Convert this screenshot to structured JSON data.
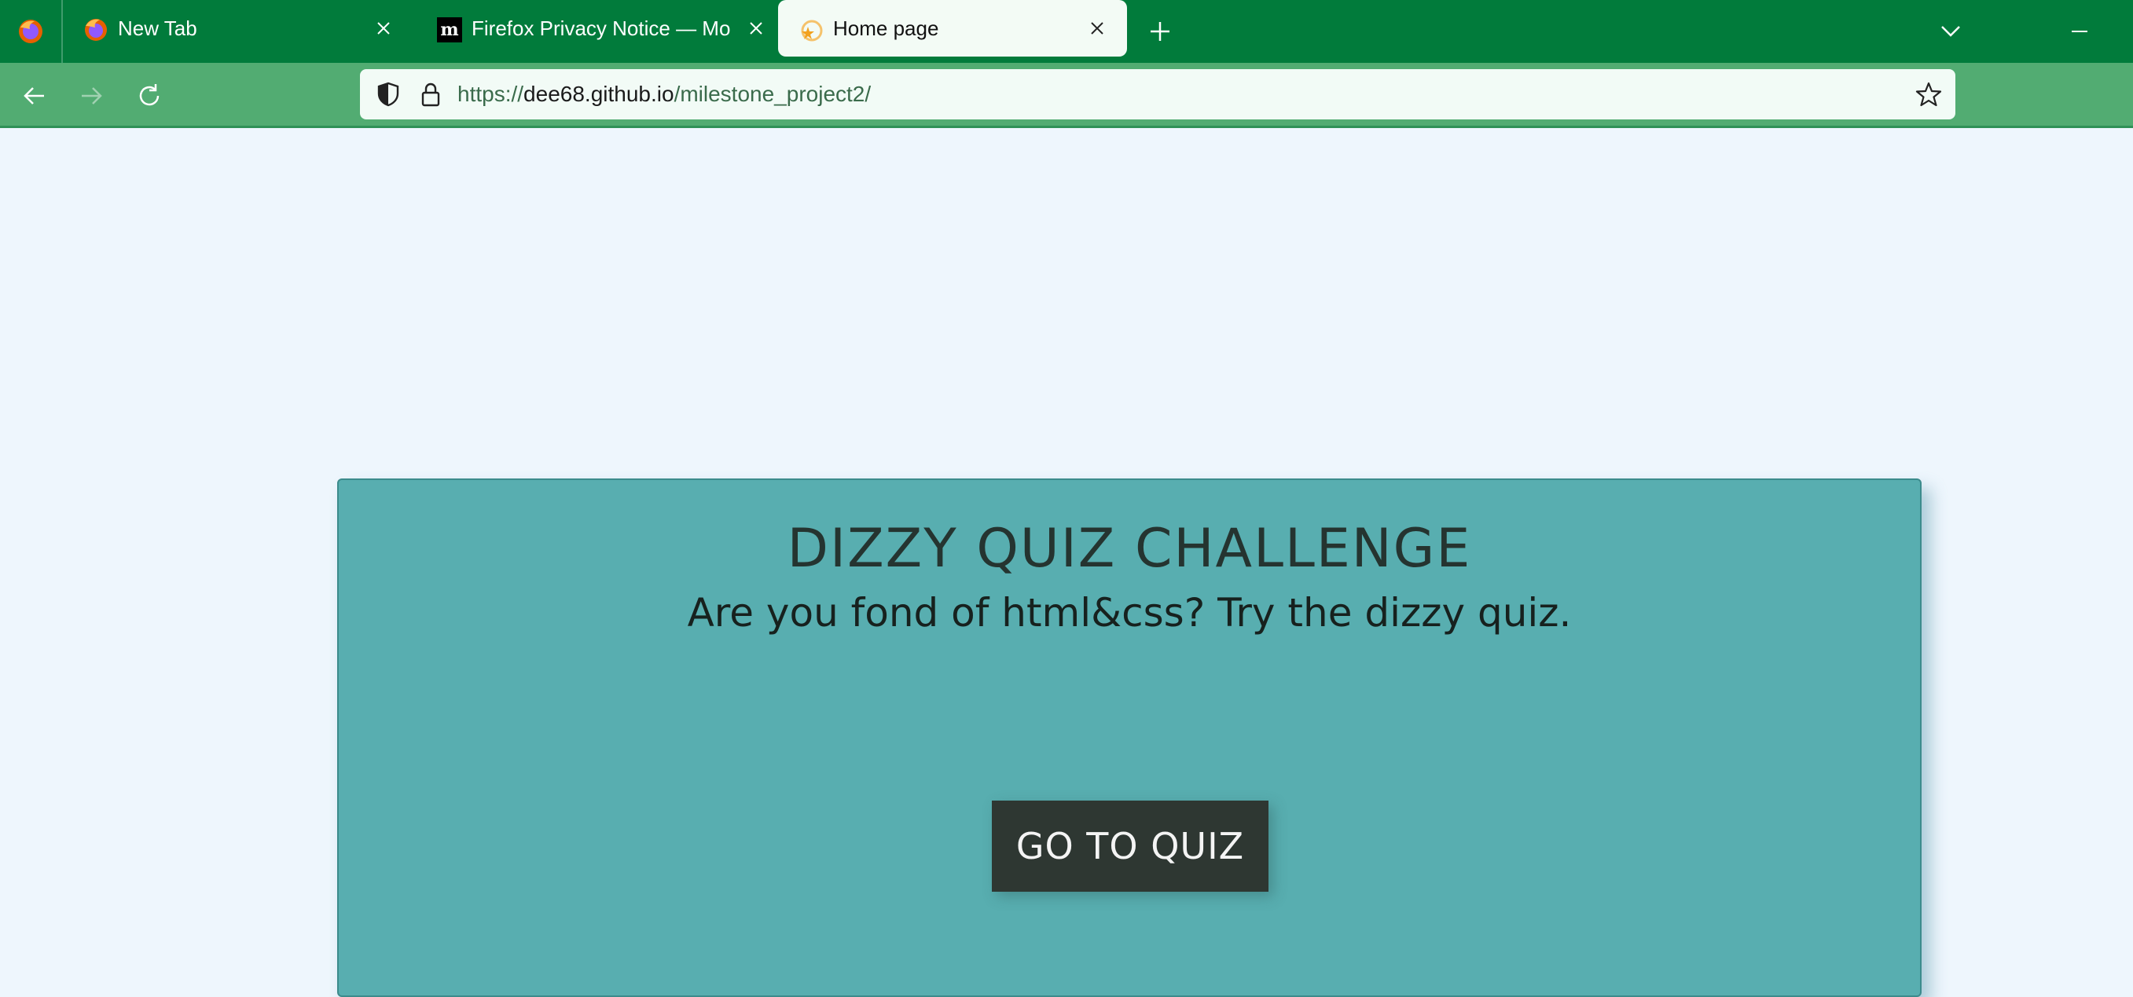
{
  "browser": {
    "tabs": [
      {
        "label": "New Tab",
        "favicon": "firefox-icon"
      },
      {
        "label": "Firefox Privacy Notice — Mozilla",
        "favicon": "mozilla-m-icon"
      },
      {
        "label": "Home page",
        "favicon": "star-favicon-icon",
        "active": true
      }
    ],
    "address": {
      "scheme": "https://",
      "host": "dee68.github.io",
      "path": "/milestone_project2/"
    },
    "colors": {
      "tabstrip": "#017b3b",
      "navbar": "#52ac72",
      "active_tab": "#f3fbf5"
    }
  },
  "page": {
    "title": "DIZZY QUIZ CHALLENGE",
    "subtitle": "Are you fond of html&css? Try the dizzy quiz.",
    "button_label": "GO TO QUIZ",
    "colors": {
      "background": "#eef6fd",
      "card": "#58aeb0",
      "button": "#2e3732"
    }
  }
}
